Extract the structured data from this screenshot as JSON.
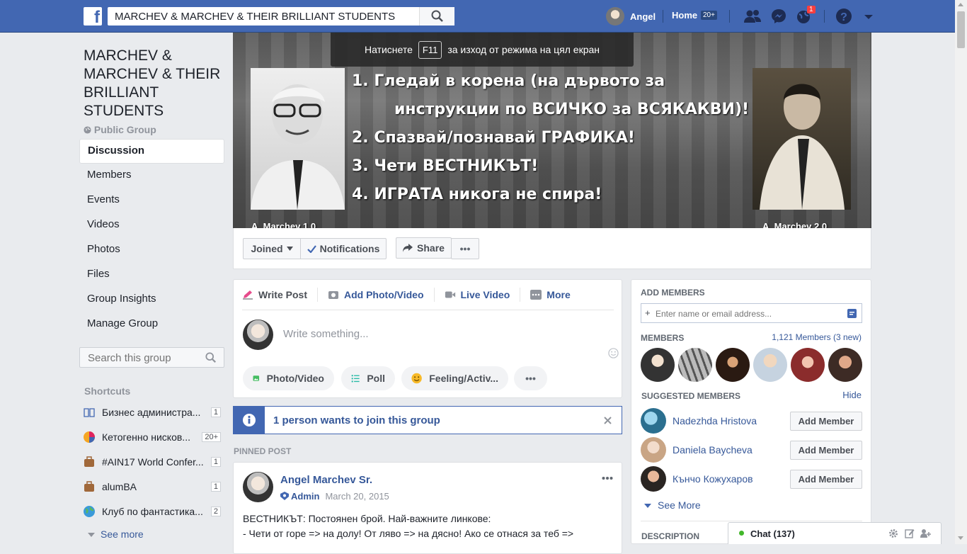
{
  "topbar": {
    "logo": "f",
    "search_value": "MARCHEV & MARCHEV & THEIR BRILLIANT STUDENTS",
    "user_name": "Angel",
    "home_label": "Home",
    "home_badge": "20+",
    "notifications_badge": "1"
  },
  "fullscreen_tip": {
    "before": "Натиснете",
    "key": "F11",
    "after": "за изход от режима на цял екран"
  },
  "group": {
    "title": "MARCHEV & MARCHEV & THEIR BRILLIANT STUDENTS",
    "type": "Public Group"
  },
  "leftnav": {
    "items": [
      "Discussion",
      "Members",
      "Events",
      "Videos",
      "Photos",
      "Files",
      "Group Insights",
      "Manage Group"
    ]
  },
  "group_search": {
    "placeholder": "Search this group"
  },
  "shortcuts": {
    "title": "Shortcuts",
    "items": [
      {
        "label": "Бизнес администра...",
        "count": "1"
      },
      {
        "label": "Кетогенно нисков...",
        "count": "20+"
      },
      {
        "label": "#AIN17 World Confer...",
        "count": "1"
      },
      {
        "label": "alumBA",
        "count": "1"
      },
      {
        "label": "Клуб по фантастика...",
        "count": "2"
      }
    ],
    "see_more": "See more"
  },
  "cover": {
    "lines": [
      "1. Гледай в корена (на дървото за",
      "инструкции по ВСИЧКО за ВСЯКАКВИ)!",
      "2. Спазвай/познавай ГРАФИКА!",
      "3. Чети ВЕСТНИКЪТ!",
      "4. ИГРАТА никога не спира!"
    ],
    "caption_left": "A. Marchev 1.0",
    "caption_right": "A. Marchev 2.0"
  },
  "cover_actions": {
    "joined": "Joined",
    "notifications": "Notifications",
    "share": "Share",
    "more": "•••"
  },
  "composer": {
    "tabs": [
      "Write Post",
      "Add Photo/Video",
      "Live Video",
      "More"
    ],
    "placeholder": "Write something...",
    "pills": [
      "Photo/Video",
      "Poll",
      "Feeling/Activ...",
      "•••"
    ]
  },
  "join_request": {
    "text": "1 person wants to join this group"
  },
  "pinned_label": "PINNED POST",
  "post": {
    "author": "Angel Marchev Sr.",
    "role": "Admin",
    "date": "March 20, 2015",
    "line1": "ВЕСТНИКЪТ: Постоянен брой. Най-важните линкове:",
    "line2": "- Чети от горе => на долу! От ляво => на дясно! Ако се отнася за теб =>"
  },
  "right": {
    "add_members_title": "ADD MEMBERS",
    "add_placeholder": "Enter name or email address...",
    "members_title": "MEMBERS",
    "members_count": "1,121 Members (3 new)",
    "suggested_title": "SUGGESTED MEMBERS",
    "hide": "Hide",
    "suggested": [
      {
        "name": "Nadezhda Hristova",
        "button": "Add Member"
      },
      {
        "name": "Daniela Baycheva",
        "button": "Add Member"
      },
      {
        "name": "Кънчо Кожухаров",
        "button": "Add Member"
      }
    ],
    "see_more": "See More",
    "description_title": "DESCRIPTION"
  },
  "chat": {
    "label": "Chat (137)"
  },
  "colors": {
    "brand": "#4267b2",
    "link": "#365899",
    "background": "#e9ebee"
  }
}
